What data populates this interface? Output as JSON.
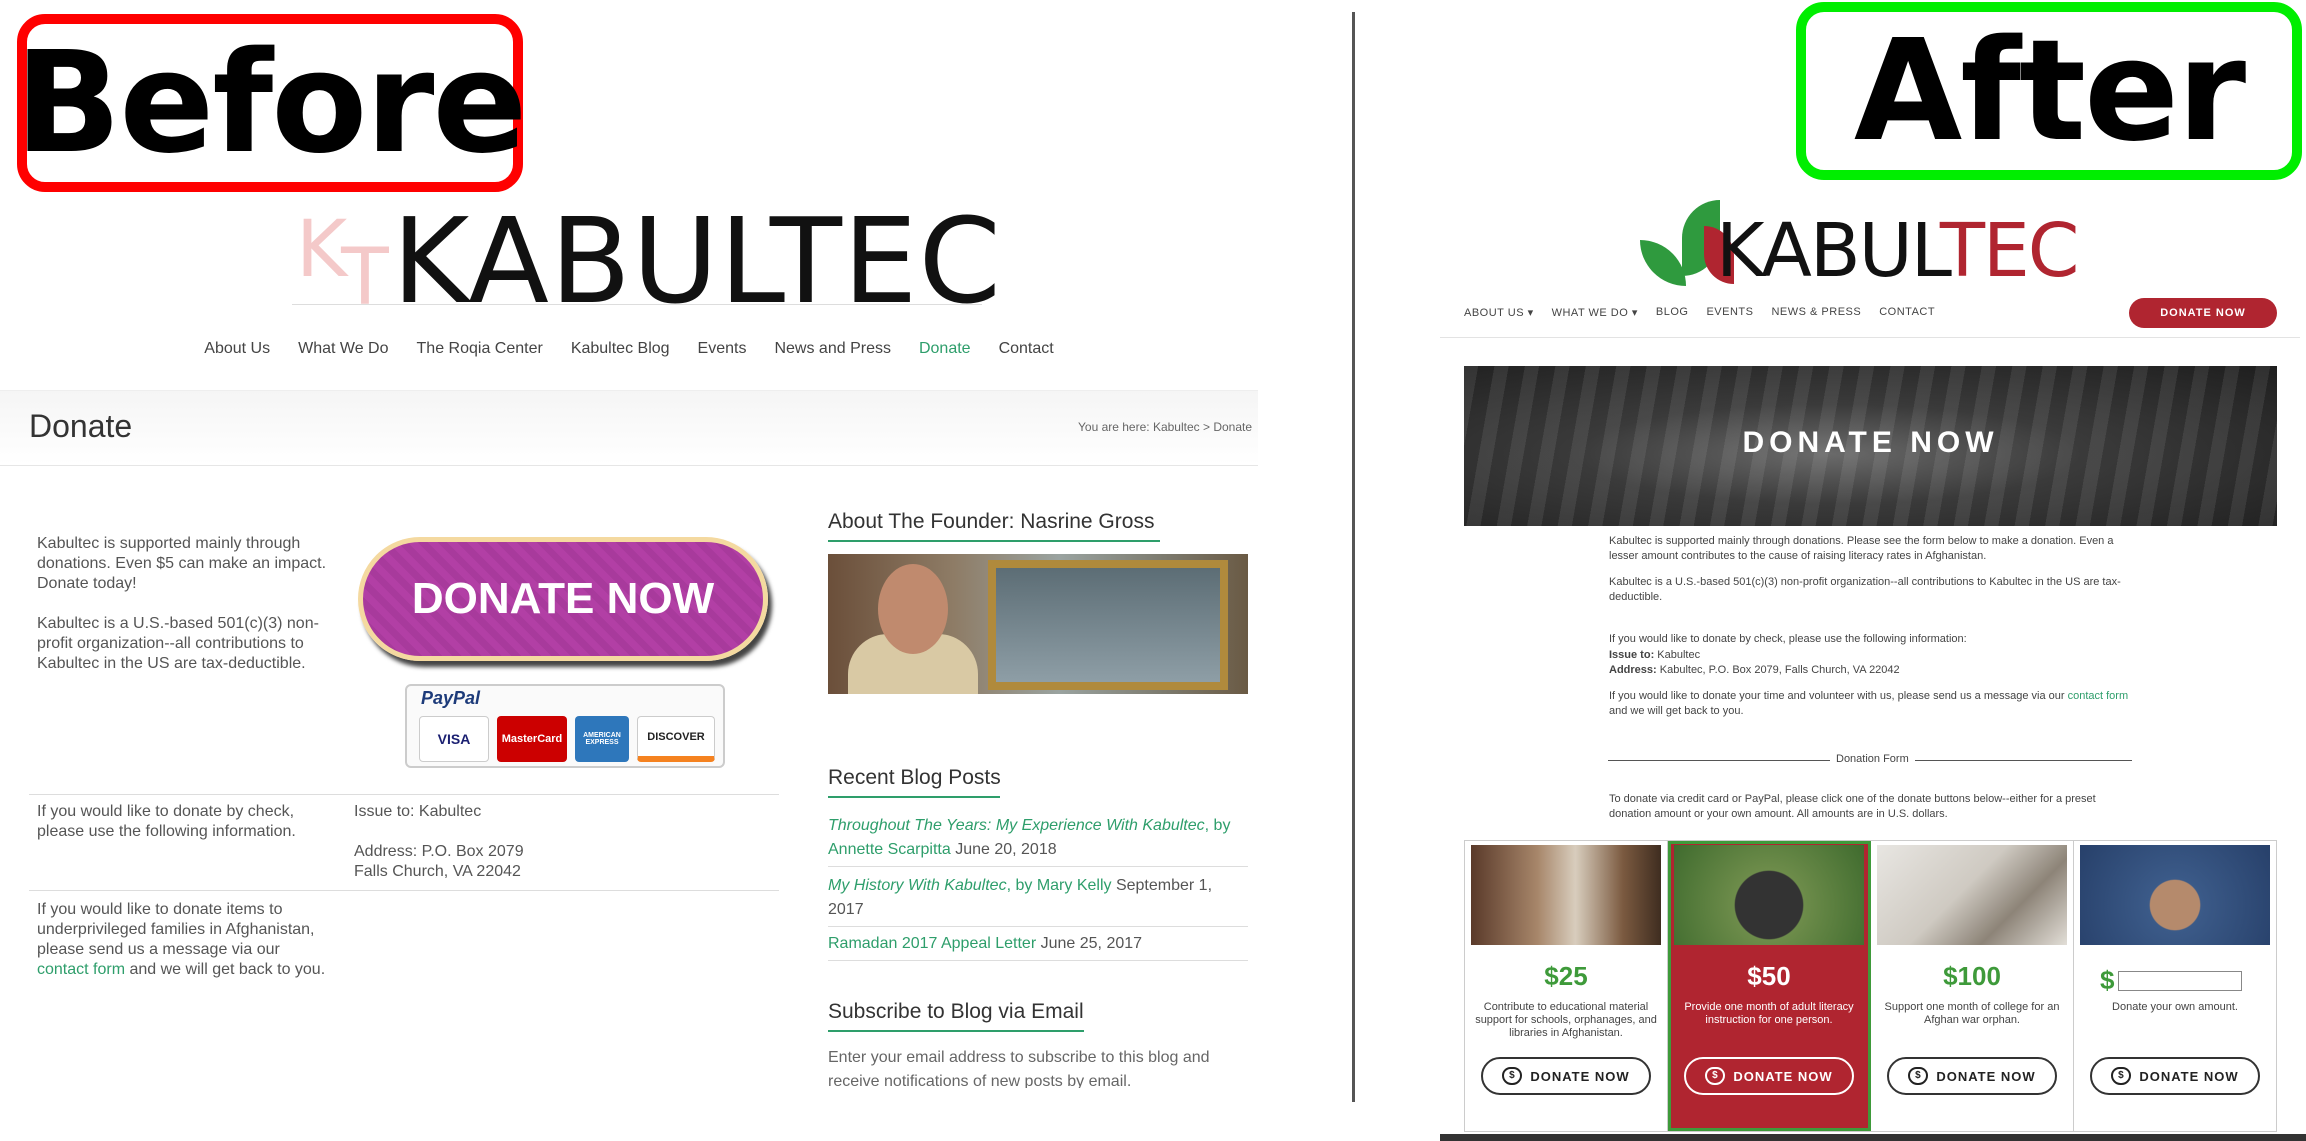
{
  "labels": {
    "before": "Before",
    "after": "After"
  },
  "before": {
    "logo_kt": [
      "K",
      "T"
    ],
    "logo": "KABULTEC",
    "nav": [
      "About Us",
      "What We Do",
      "The Roqia Center",
      "Kabultec Blog",
      "Events",
      "News and Press",
      "Donate",
      "Contact"
    ],
    "nav_active": "Donate",
    "page_title": "Donate",
    "breadcrumb": "You are here: Kabultec > Donate",
    "intro1": "Kabultec is supported mainly through donations. Even $5 can make an impact. Donate today!",
    "intro2": "Kabultec is a U.S.-based 501(c)(3) non-profit organization--all contributions to Kabultec in the US are tax-deductible.",
    "donate_button": "DONATE NOW",
    "paypal": "PayPal",
    "cards": [
      "VISA",
      "MasterCard",
      "AMERICAN EXPRESS",
      "DISCOVER"
    ],
    "check_text": "If you would like to donate by check, please use the following information.",
    "issue_to": "Issue to: Kabultec",
    "address1": "Address: P.O. Box 2079",
    "address2": "Falls Church, VA 22042",
    "items_text_a": "If you would like to donate items to underprivileged families in Afghanistan, please send us a message via our",
    "items_link": "contact form",
    "items_text_b": "and we will get back to you.",
    "sidebar": {
      "founder_heading": "About The Founder: Nasrine Gross",
      "recent_heading": "Recent Blog Posts",
      "posts": [
        {
          "title": "Throughout The Years: My Experience With Kabultec",
          "by": ", by Annette Scarpitta",
          "date": "June 20, 2018"
        },
        {
          "title": "My History With Kabultec",
          "by": ", by Mary Kelly",
          "date": "September 1, 2017"
        },
        {
          "title": "Ramadan 2017 Appeal Letter",
          "by": "",
          "date": "June 25, 2017"
        }
      ],
      "subscribe_heading": "Subscribe to Blog via Email",
      "subscribe_text": "Enter your email address to subscribe to this blog and receive notifications of new posts by email."
    }
  },
  "after": {
    "logo_main": "KABUL",
    "logo_red": "TEC",
    "nav": [
      "ABOUT US ▾",
      "WHAT WE DO ▾",
      "BLOG",
      "EVENTS",
      "NEWS & PRESS",
      "CONTACT"
    ],
    "donate_top": "DONATE NOW",
    "hero": "DONATE NOW",
    "p1": "Kabultec is supported mainly through donations. Please see the form below to make a donation.  Even a lesser amount contributes to the cause of raising literacy rates in Afghanistan.",
    "p2": "Kabultec is a U.S.-based 501(c)(3) non-profit organization--all contributions to Kabultec in the US are tax-deductible.",
    "p3": "If you would like to donate by check, please use the following information:",
    "issue_label": "Issue to:",
    "issue_value": "Kabultec",
    "address_label": "Address:",
    "address_value": "Kabultec, P.O. Box 2079, Falls Church, VA 22042",
    "p4a": "If you would like to donate your time and volunteer with us, please send us a message via our",
    "p4_link": "contact form",
    "p4b": "and we will get back to you.",
    "form_label": "Donation Form",
    "form_intro": "To donate via credit card or PayPal, please click one of the donate buttons below--either for a preset donation amount or your own amount.  All amounts are in U.S. dollars.",
    "options": [
      {
        "amount": "$25",
        "desc": "Contribute to educational material support for schools, orphanages, and libraries in Afghanistan.",
        "button": "DONATE NOW"
      },
      {
        "amount": "$50",
        "desc": "Provide one month of adult literacy instruction for one person.",
        "button": "DONATE NOW"
      },
      {
        "amount": "$100",
        "desc": "Support one month of college for an Afghan war orphan.",
        "button": "DONATE NOW"
      },
      {
        "amount": "$",
        "desc": "Donate your own amount.",
        "button": "DONATE NOW"
      }
    ]
  },
  "colors": {
    "accent_green": "#2e9e6b",
    "brand_red": "#b02530",
    "before_border": "#ff0000",
    "after_border": "#00ee00"
  }
}
